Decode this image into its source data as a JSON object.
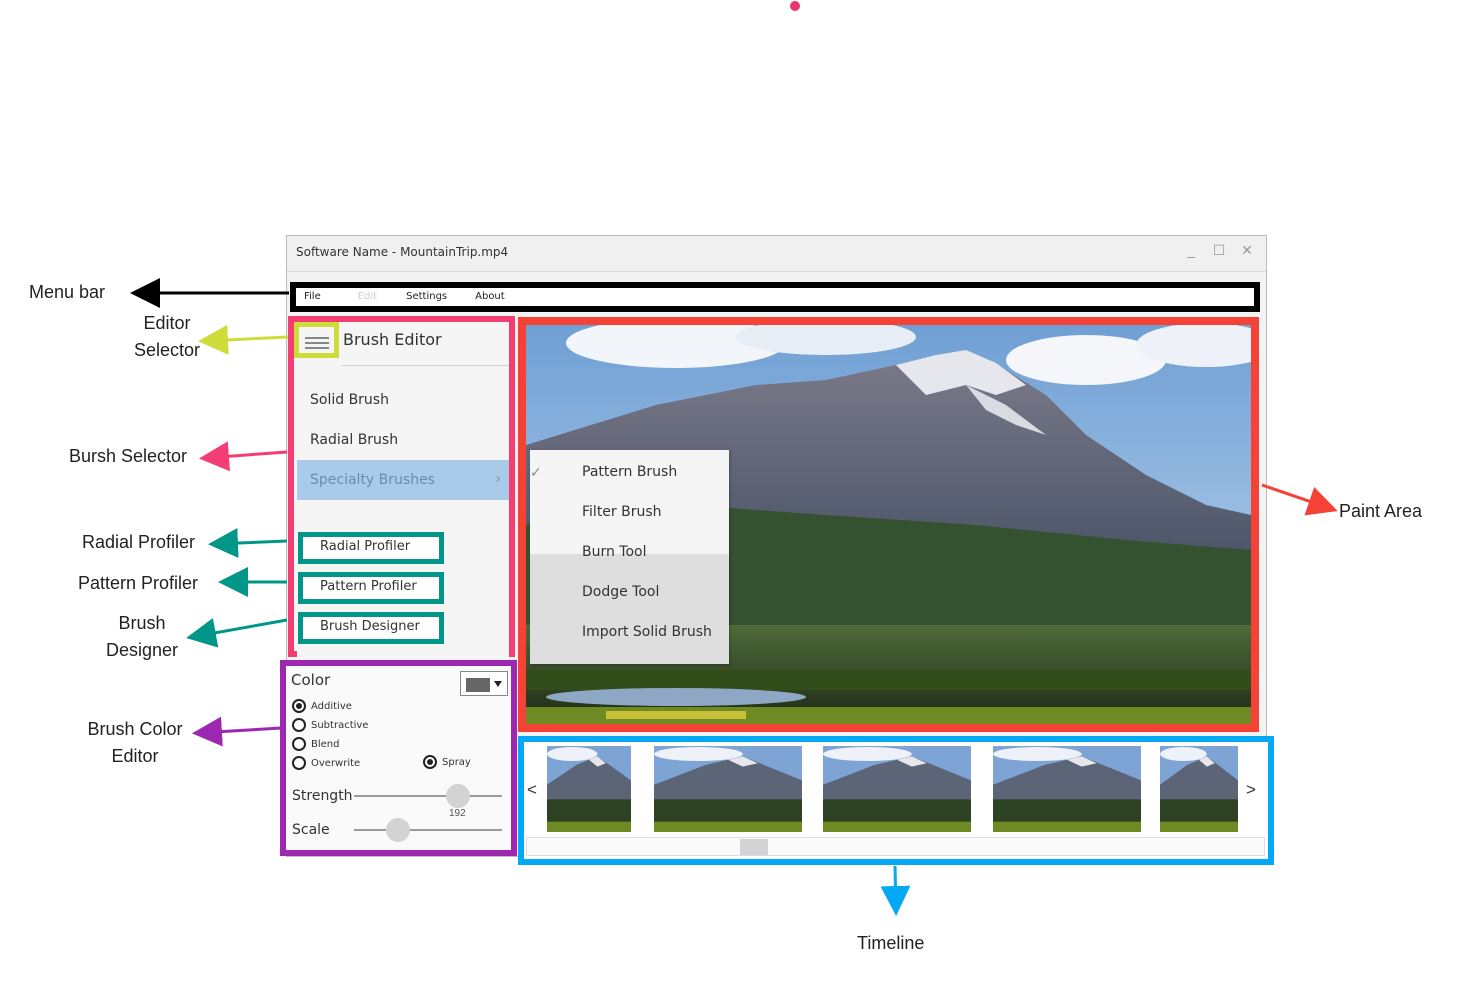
{
  "window": {
    "title": "Software Name  -  MountainTrip.mp4",
    "controls": {
      "minimize": "_",
      "maximize": "☐",
      "close": "✕"
    }
  },
  "menu": {
    "items": [
      {
        "label": "File",
        "enabled": true
      },
      {
        "label": "Edit",
        "enabled": false
      },
      {
        "label": "Settings",
        "enabled": true
      },
      {
        "label": "About",
        "enabled": true
      }
    ]
  },
  "brush_editor": {
    "title": "Brush Editor",
    "selector_icon": "hamburger-menu-icon",
    "brushes": [
      {
        "label": "Solid Brush",
        "active": false
      },
      {
        "label": "Radial Brush",
        "active": false
      },
      {
        "label": "Specialty Brushes",
        "active": true,
        "submenu_icon": "chevron-right-icon",
        "chevron": "›"
      }
    ],
    "profilers": [
      "Radial Profiler",
      "Pattern Profiler",
      "Brush Designer"
    ]
  },
  "specialty_menu": {
    "check_mark": "✓",
    "items": [
      "Pattern Brush",
      "Filter Brush",
      "Burn Tool",
      "Dodge Tool",
      "Import Solid Brush"
    ]
  },
  "color_editor": {
    "label": "Color",
    "swatch_color": "#666666",
    "blend_modes": [
      {
        "label": "Additive",
        "selected": true
      },
      {
        "label": "Subtractive",
        "selected": false
      },
      {
        "label": "Blend",
        "selected": false
      },
      {
        "label": "Overwrite",
        "selected": false
      }
    ],
    "spray": {
      "label": "Spray",
      "selected": true
    },
    "strength": {
      "label": "Strength",
      "value": "192",
      "fraction": 0.7
    },
    "scale": {
      "label": "Scale",
      "fraction": 0.3
    }
  },
  "timeline": {
    "prev": "<",
    "next": ">",
    "frame_count": 5,
    "scroll_fraction": 0.3
  },
  "annotations": {
    "menu_bar": "Menu bar",
    "editor_selector": [
      "Editor",
      "Selector"
    ],
    "brush_selector": "Bursh Selector",
    "radial_profiler": "Radial Profiler",
    "pattern_profiler": "Pattern Profiler",
    "brush_designer": [
      "Brush",
      "Designer"
    ],
    "brush_color_editor": [
      "Brush Color",
      "Editor"
    ],
    "paint_area": "Paint Area",
    "timeline": "Timeline"
  },
  "colors": {
    "menu_bar": "#000000",
    "editor_selector": "#cddc39",
    "brush_selector": "#f43e73",
    "profilers": "#009688",
    "color_editor": "#9c27b0",
    "paint_area": "#f44336",
    "timeline": "#03a9f4"
  }
}
